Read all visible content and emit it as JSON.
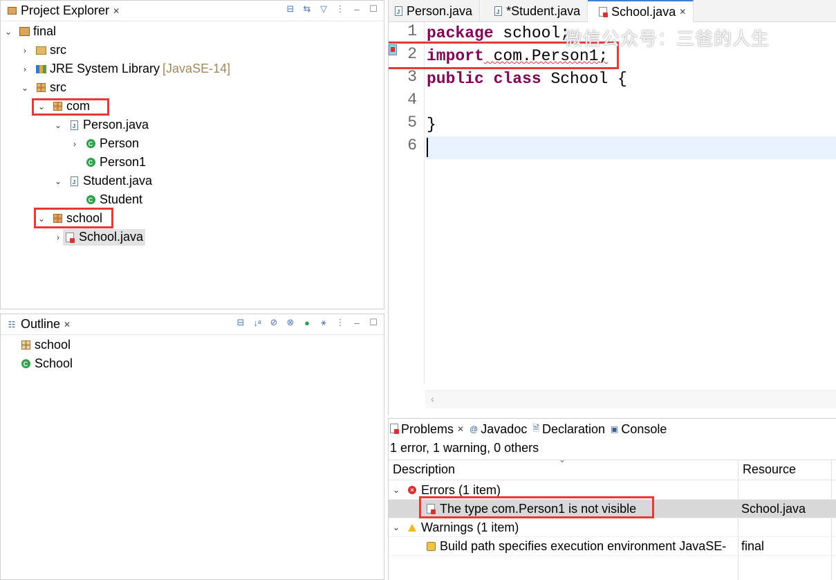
{
  "project_explorer": {
    "title": "Project Explorer",
    "items": [
      {
        "label": "final"
      },
      {
        "label": "src"
      },
      {
        "label": "JRE System Library",
        "decoration": "[JavaSE-14]"
      },
      {
        "label": "src"
      },
      {
        "label": "com"
      },
      {
        "label": "Person.java"
      },
      {
        "label": "Person"
      },
      {
        "label": "Person1"
      },
      {
        "label": "Student.java"
      },
      {
        "label": "Student"
      },
      {
        "label": "school"
      },
      {
        "label": "School.java"
      }
    ]
  },
  "outline": {
    "title": "Outline",
    "items": [
      {
        "label": "school"
      },
      {
        "label": "School"
      }
    ]
  },
  "editor": {
    "tabs": [
      {
        "label": "Person.java"
      },
      {
        "label": "*Student.java"
      },
      {
        "label": "School.java"
      }
    ],
    "lines": [
      {
        "number": "1",
        "kw": "package",
        "rest": " school;"
      },
      {
        "number": "2",
        "kw": "import",
        "rest": " com.Person1;"
      },
      {
        "number": "3",
        "kw": "public class",
        "rest": " School {"
      },
      {
        "number": "4",
        "kw": "",
        "rest": ""
      },
      {
        "number": "5",
        "kw": "",
        "rest": "}"
      },
      {
        "number": "6",
        "kw": "",
        "rest": ""
      }
    ],
    "watermark": "微信公众号：三爸的人生"
  },
  "problems": {
    "tabs": [
      {
        "label": "Problems"
      },
      {
        "label": "Javadoc"
      },
      {
        "label": "Declaration"
      },
      {
        "label": "Console"
      }
    ],
    "summary": "1 error, 1 warning, 0 others",
    "columns": [
      "Description",
      "Resource"
    ],
    "rows": [
      {
        "description": "Errors (1 item)",
        "resource": ""
      },
      {
        "description": "The type com.Person1 is not visible",
        "resource": "School.java"
      },
      {
        "description": "Warnings (1 item)",
        "resource": ""
      },
      {
        "description": "Build path specifies execution environment JavaSE-",
        "resource": "final"
      }
    ]
  },
  "colors": {
    "highlight": "#e5393a",
    "keyword": "#7f0055",
    "current_line": "#e8f2fe"
  }
}
